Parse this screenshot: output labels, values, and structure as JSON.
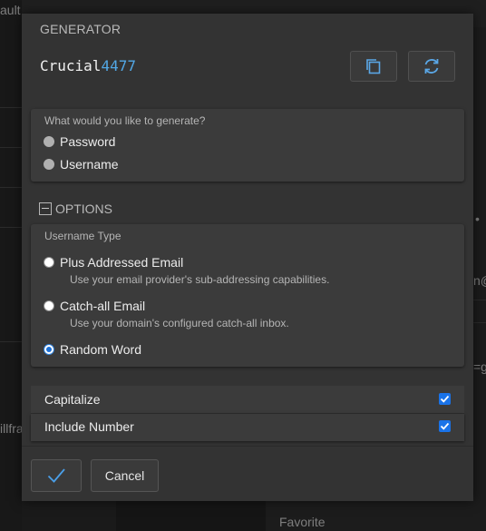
{
  "background": {
    "top_text": "ault",
    "left_text": "illfra",
    "right_text_1": "n@",
    "right_text_2": "=g",
    "bottom_text": "Favorite"
  },
  "dialog": {
    "title": "GENERATOR",
    "generated_value": {
      "letters": "Crucial",
      "digits": "4477"
    },
    "copy_button_icon": "copy-icon",
    "regenerate_button_icon": "refresh-icon",
    "generate_type": {
      "question": "What would you like to generate?",
      "options": [
        {
          "label": "Password",
          "checked": false
        },
        {
          "label": "Username",
          "checked": false
        }
      ]
    },
    "options_header": "OPTIONS",
    "username_type": {
      "label": "Username Type",
      "options": [
        {
          "label": "Plus Addressed Email",
          "description": "Use your email provider's sub-addressing capabilities.",
          "checked": false
        },
        {
          "label": "Catch-all Email",
          "description": "Use your domain's configured catch-all inbox.",
          "checked": false
        },
        {
          "label": "Random Word",
          "description": "",
          "checked": true
        }
      ]
    },
    "checkboxes": [
      {
        "label": "Capitalize",
        "checked": true
      },
      {
        "label": "Include Number",
        "checked": true
      }
    ],
    "footer": {
      "confirm_icon": "checkmark-icon",
      "cancel_label": "Cancel"
    }
  },
  "colors": {
    "accent": "#1a73e8",
    "digits": "#52a8e6",
    "dialog_bg": "#333333",
    "panel_bg": "#3b3b3b"
  }
}
